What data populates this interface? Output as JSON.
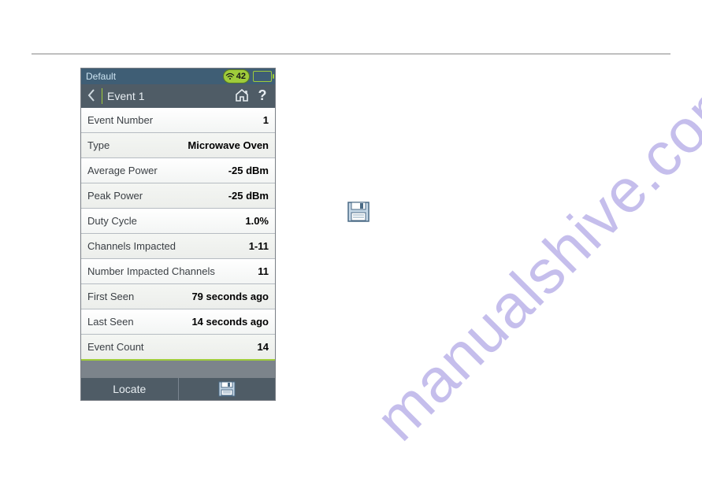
{
  "status": {
    "title": "Default",
    "wifi_value": "42"
  },
  "nav": {
    "title": "Event 1"
  },
  "rows": [
    {
      "label": "Event Number",
      "value": "1"
    },
    {
      "label": "Type",
      "value": "Microwave Oven"
    },
    {
      "label": "Average Power",
      "value": "-25 dBm"
    },
    {
      "label": "Peak Power",
      "value": "-25 dBm"
    },
    {
      "label": "Duty Cycle",
      "value": "1.0%"
    },
    {
      "label": "Channels Impacted",
      "value": "1-11"
    },
    {
      "label": "Number Impacted Channels",
      "value": "11"
    },
    {
      "label": "First Seen",
      "value": "79  seconds ago"
    },
    {
      "label": "Last Seen",
      "value": "14  seconds ago"
    },
    {
      "label": "Event Count",
      "value": "14"
    }
  ],
  "footer": {
    "locate_label": "Locate"
  },
  "watermark": "manualshive.com"
}
